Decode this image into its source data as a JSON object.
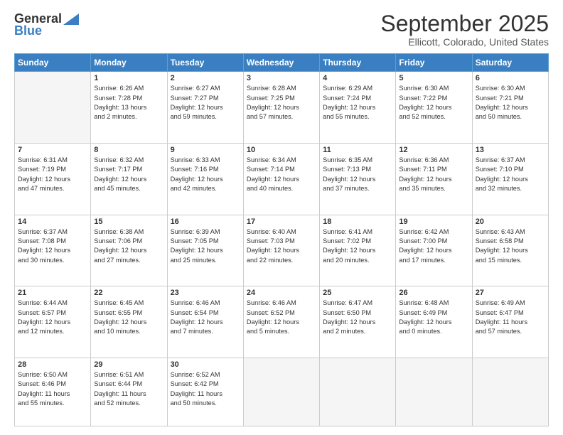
{
  "header": {
    "logo_general": "General",
    "logo_blue": "Blue",
    "title": "September 2025",
    "subtitle": "Ellicott, Colorado, United States"
  },
  "weekdays": [
    "Sunday",
    "Monday",
    "Tuesday",
    "Wednesday",
    "Thursday",
    "Friday",
    "Saturday"
  ],
  "weeks": [
    [
      {
        "day": "",
        "info": ""
      },
      {
        "day": "1",
        "info": "Sunrise: 6:26 AM\nSunset: 7:28 PM\nDaylight: 13 hours\nand 2 minutes."
      },
      {
        "day": "2",
        "info": "Sunrise: 6:27 AM\nSunset: 7:27 PM\nDaylight: 12 hours\nand 59 minutes."
      },
      {
        "day": "3",
        "info": "Sunrise: 6:28 AM\nSunset: 7:25 PM\nDaylight: 12 hours\nand 57 minutes."
      },
      {
        "day": "4",
        "info": "Sunrise: 6:29 AM\nSunset: 7:24 PM\nDaylight: 12 hours\nand 55 minutes."
      },
      {
        "day": "5",
        "info": "Sunrise: 6:30 AM\nSunset: 7:22 PM\nDaylight: 12 hours\nand 52 minutes."
      },
      {
        "day": "6",
        "info": "Sunrise: 6:30 AM\nSunset: 7:21 PM\nDaylight: 12 hours\nand 50 minutes."
      }
    ],
    [
      {
        "day": "7",
        "info": "Sunrise: 6:31 AM\nSunset: 7:19 PM\nDaylight: 12 hours\nand 47 minutes."
      },
      {
        "day": "8",
        "info": "Sunrise: 6:32 AM\nSunset: 7:17 PM\nDaylight: 12 hours\nand 45 minutes."
      },
      {
        "day": "9",
        "info": "Sunrise: 6:33 AM\nSunset: 7:16 PM\nDaylight: 12 hours\nand 42 minutes."
      },
      {
        "day": "10",
        "info": "Sunrise: 6:34 AM\nSunset: 7:14 PM\nDaylight: 12 hours\nand 40 minutes."
      },
      {
        "day": "11",
        "info": "Sunrise: 6:35 AM\nSunset: 7:13 PM\nDaylight: 12 hours\nand 37 minutes."
      },
      {
        "day": "12",
        "info": "Sunrise: 6:36 AM\nSunset: 7:11 PM\nDaylight: 12 hours\nand 35 minutes."
      },
      {
        "day": "13",
        "info": "Sunrise: 6:37 AM\nSunset: 7:10 PM\nDaylight: 12 hours\nand 32 minutes."
      }
    ],
    [
      {
        "day": "14",
        "info": "Sunrise: 6:37 AM\nSunset: 7:08 PM\nDaylight: 12 hours\nand 30 minutes."
      },
      {
        "day": "15",
        "info": "Sunrise: 6:38 AM\nSunset: 7:06 PM\nDaylight: 12 hours\nand 27 minutes."
      },
      {
        "day": "16",
        "info": "Sunrise: 6:39 AM\nSunset: 7:05 PM\nDaylight: 12 hours\nand 25 minutes."
      },
      {
        "day": "17",
        "info": "Sunrise: 6:40 AM\nSunset: 7:03 PM\nDaylight: 12 hours\nand 22 minutes."
      },
      {
        "day": "18",
        "info": "Sunrise: 6:41 AM\nSunset: 7:02 PM\nDaylight: 12 hours\nand 20 minutes."
      },
      {
        "day": "19",
        "info": "Sunrise: 6:42 AM\nSunset: 7:00 PM\nDaylight: 12 hours\nand 17 minutes."
      },
      {
        "day": "20",
        "info": "Sunrise: 6:43 AM\nSunset: 6:58 PM\nDaylight: 12 hours\nand 15 minutes."
      }
    ],
    [
      {
        "day": "21",
        "info": "Sunrise: 6:44 AM\nSunset: 6:57 PM\nDaylight: 12 hours\nand 12 minutes."
      },
      {
        "day": "22",
        "info": "Sunrise: 6:45 AM\nSunset: 6:55 PM\nDaylight: 12 hours\nand 10 minutes."
      },
      {
        "day": "23",
        "info": "Sunrise: 6:46 AM\nSunset: 6:54 PM\nDaylight: 12 hours\nand 7 minutes."
      },
      {
        "day": "24",
        "info": "Sunrise: 6:46 AM\nSunset: 6:52 PM\nDaylight: 12 hours\nand 5 minutes."
      },
      {
        "day": "25",
        "info": "Sunrise: 6:47 AM\nSunset: 6:50 PM\nDaylight: 12 hours\nand 2 minutes."
      },
      {
        "day": "26",
        "info": "Sunrise: 6:48 AM\nSunset: 6:49 PM\nDaylight: 12 hours\nand 0 minutes."
      },
      {
        "day": "27",
        "info": "Sunrise: 6:49 AM\nSunset: 6:47 PM\nDaylight: 11 hours\nand 57 minutes."
      }
    ],
    [
      {
        "day": "28",
        "info": "Sunrise: 6:50 AM\nSunset: 6:46 PM\nDaylight: 11 hours\nand 55 minutes."
      },
      {
        "day": "29",
        "info": "Sunrise: 6:51 AM\nSunset: 6:44 PM\nDaylight: 11 hours\nand 52 minutes."
      },
      {
        "day": "30",
        "info": "Sunrise: 6:52 AM\nSunset: 6:42 PM\nDaylight: 11 hours\nand 50 minutes."
      },
      {
        "day": "",
        "info": ""
      },
      {
        "day": "",
        "info": ""
      },
      {
        "day": "",
        "info": ""
      },
      {
        "day": "",
        "info": ""
      }
    ]
  ]
}
